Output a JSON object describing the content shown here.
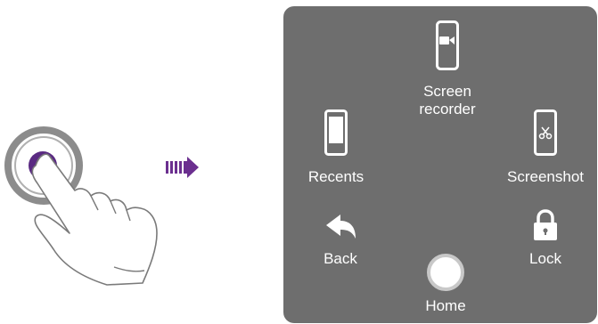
{
  "arrow_color": "#6b2f8f",
  "panel_color": "#6e6e6e",
  "menu": {
    "screen_recorder": {
      "label_line1": "Screen",
      "label_line2": "recorder",
      "icon": "screen-recorder-icon"
    },
    "recents": {
      "label": "Recents",
      "icon": "recents-icon"
    },
    "screenshot": {
      "label": "Screenshot",
      "icon": "screenshot-icon"
    },
    "back": {
      "label": "Back",
      "icon": "back-icon"
    },
    "lock": {
      "label": "Lock",
      "icon": "lock-icon"
    },
    "home": {
      "label": "Home",
      "icon": "home-icon"
    }
  }
}
